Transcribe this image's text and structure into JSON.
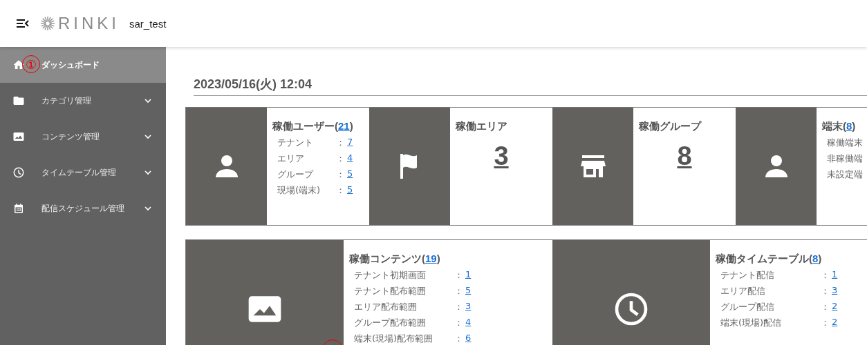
{
  "header": {
    "logo": "RINKI",
    "user": "sar_test"
  },
  "sidebar": {
    "items": [
      {
        "label": "ダッシュボード",
        "selected": true,
        "expandable": false
      },
      {
        "label": "カテゴリ管理",
        "selected": false,
        "expandable": true
      },
      {
        "label": "コンテンツ管理",
        "selected": false,
        "expandable": true
      },
      {
        "label": "タイムテーブル管理",
        "selected": false,
        "expandable": true
      },
      {
        "label": "配信スケジュール管理",
        "selected": false,
        "expandable": true
      }
    ]
  },
  "annotation": {
    "text": "①"
  },
  "date": "2023/05/16(火) 12:04",
  "rows": [
    {
      "cards": [
        {
          "kind": "list",
          "title": "稼働ユーザー(",
          "count": "21",
          "title_end": ")",
          "items": [
            {
              "label": "テナント",
              "colon": "：",
              "value": "7"
            },
            {
              "label": "エリア",
              "colon": "：",
              "value": "4"
            },
            {
              "label": "グループ",
              "colon": "：",
              "value": "5"
            },
            {
              "label": "現場(端末)",
              "colon": "：",
              "value": "5"
            }
          ]
        },
        {
          "kind": "big",
          "title": "稼働エリア",
          "value": "3"
        },
        {
          "kind": "big",
          "title": "稼働グループ",
          "value": "8"
        },
        {
          "kind": "list",
          "title": "端末(",
          "count": "8",
          "title_end": ")",
          "items": [
            {
              "label": "稼働端末"
            },
            {
              "label": "非稼働端"
            },
            {
              "label": "未設定端"
            }
          ]
        }
      ]
    },
    {
      "cards": [
        {
          "kind": "list",
          "title": "稼働コンテンツ(",
          "count": "19",
          "title_end": ")",
          "items": [
            {
              "label": "テナント初期画面",
              "colon": "：",
              "value": "1"
            },
            {
              "label": "テナント配布範囲",
              "colon": "：",
              "value": "5"
            },
            {
              "label": "エリア配布範囲",
              "colon": "：",
              "value": "3"
            },
            {
              "label": "グループ配布範囲",
              "colon": "：",
              "value": "4"
            },
            {
              "label": "端末(現場)配布範囲",
              "colon": "：",
              "value": "6"
            }
          ]
        },
        {
          "kind": "list",
          "title": "稼働タイムテーブル(",
          "count": "8",
          "title_end": ")",
          "items": [
            {
              "label": "テナント配信",
              "colon": "：",
              "value": "1"
            },
            {
              "label": "エリア配信",
              "colon": "：",
              "value": "3"
            },
            {
              "label": "グループ配信",
              "colon": "：",
              "value": "2"
            },
            {
              "label": "端末(現場)配信",
              "colon": "：",
              "value": "2"
            }
          ]
        }
      ]
    }
  ]
}
